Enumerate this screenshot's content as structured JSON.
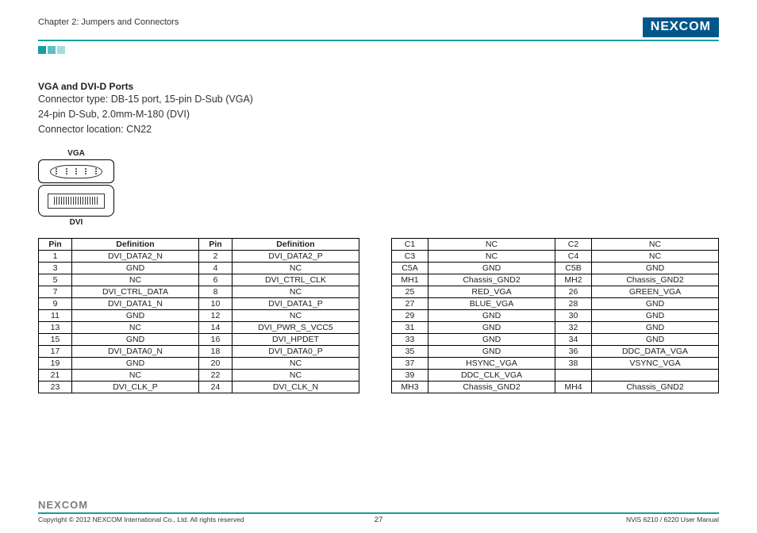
{
  "header": {
    "chapter": "Chapter 2: Jumpers and Connectors",
    "brand": "NEXCOM"
  },
  "section": {
    "title": "VGA and DVI-D Ports",
    "line1": "Connector type: DB-15 port, 15-pin D-Sub (VGA)",
    "line2": "24-pin D-Sub, 2.0mm-M-180 (DVI)",
    "line3": "Connector location: CN22"
  },
  "figure": {
    "top_label": "VGA",
    "bottom_label": "DVI"
  },
  "table1": {
    "headers": [
      "Pin",
      "Definition",
      "Pin",
      "Definition"
    ],
    "rows": [
      [
        "1",
        "DVI_DATA2_N",
        "2",
        "DVI_DATA2_P"
      ],
      [
        "3",
        "GND",
        "4",
        "NC"
      ],
      [
        "5",
        "NC",
        "6",
        "DVI_CTRL_CLK"
      ],
      [
        "7",
        "DVI_CTRL_DATA",
        "8",
        "NC"
      ],
      [
        "9",
        "DVI_DATA1_N",
        "10",
        "DVI_DATA1_P"
      ],
      [
        "11",
        "GND",
        "12",
        "NC"
      ],
      [
        "13",
        "NC",
        "14",
        "DVI_PWR_S_VCC5"
      ],
      [
        "15",
        "GND",
        "16",
        "DVI_HPDET"
      ],
      [
        "17",
        "DVI_DATA0_N",
        "18",
        "DVI_DATA0_P"
      ],
      [
        "19",
        "GND",
        "20",
        "NC"
      ],
      [
        "21",
        "NC",
        "22",
        "NC"
      ],
      [
        "23",
        "DVI_CLK_P",
        "24",
        "DVI_CLK_N"
      ]
    ]
  },
  "table2": {
    "rows": [
      [
        "C1",
        "NC",
        "C2",
        "NC"
      ],
      [
        "C3",
        "NC",
        "C4",
        "NC"
      ],
      [
        "C5A",
        "GND",
        "C5B",
        "GND"
      ],
      [
        "MH1",
        "Chassis_GND2",
        "MH2",
        "Chassis_GND2"
      ],
      [
        "25",
        "RED_VGA",
        "26",
        "GREEN_VGA"
      ],
      [
        "27",
        "BLUE_VGA",
        "28",
        "GND"
      ],
      [
        "29",
        "GND",
        "30",
        "GND"
      ],
      [
        "31",
        "GND",
        "32",
        "GND"
      ],
      [
        "33",
        "GND",
        "34",
        "GND"
      ],
      [
        "35",
        "GND",
        "36",
        "DDC_DATA_VGA"
      ],
      [
        "37",
        "HSYNC_VGA",
        "38",
        "VSYNC_VGA"
      ],
      [
        "39",
        "DDC_CLK_VGA",
        "",
        ""
      ],
      [
        "MH3",
        "Chassis_GND2",
        "MH4",
        "Chassis_GND2"
      ]
    ]
  },
  "footer": {
    "brand": "NEXCOM",
    "copyright": "Copyright © 2012 NEXCOM International Co., Ltd. All rights reserved",
    "page": "27",
    "manual": "NViS 6210 / 6220 User Manual"
  }
}
